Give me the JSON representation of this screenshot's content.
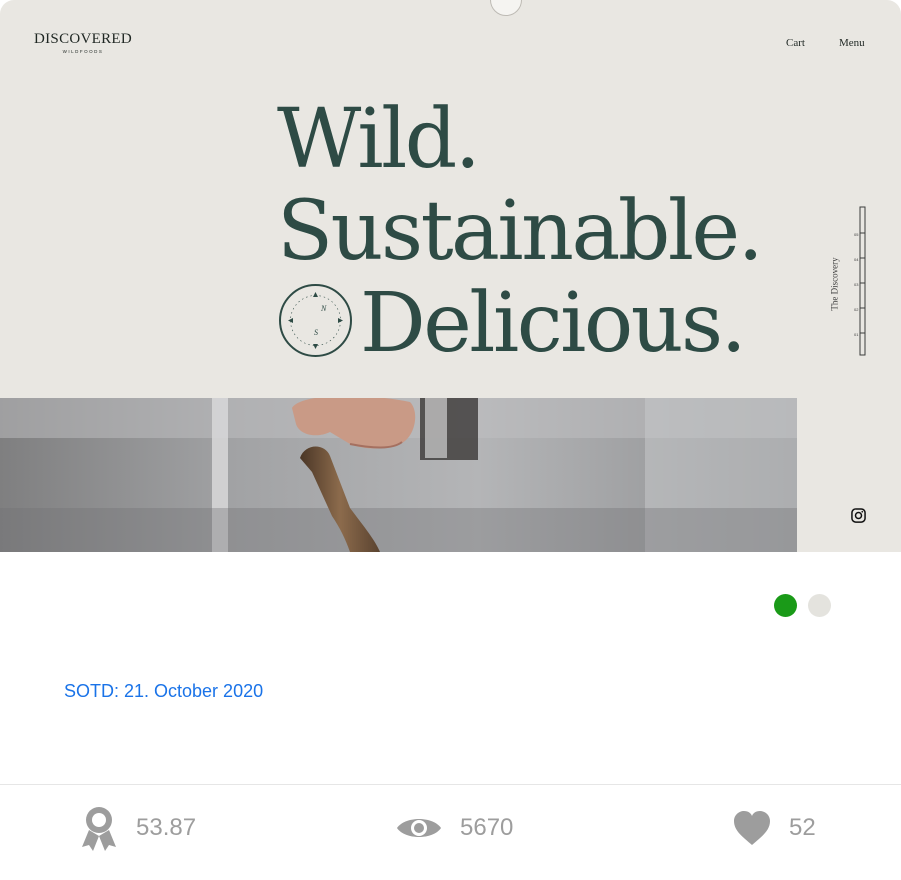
{
  "site": {
    "logo_main": "DISCOVERED",
    "logo_sub": "WILDFOODS",
    "nav": {
      "cart": "Cart",
      "menu": "Menu"
    },
    "headline": [
      "Wild.",
      "Sustainable.",
      "Delicious."
    ],
    "side_label": "The Discovery",
    "ruler_marks": [
      "05",
      "04",
      "03",
      "02",
      "01"
    ],
    "compass_letters": {
      "north": "N",
      "south": "S"
    }
  },
  "colors": {
    "background": "#e9e7e2",
    "headline": "#2e4b45",
    "dot_active": "#1a9a18",
    "dot_inactive": "#e4e3de",
    "link": "#1a73e8",
    "stat": "#9d9d9d"
  },
  "carousel": {
    "slides": 2,
    "active_index": 0
  },
  "award": {
    "label": "SOTD: 21. October 2020"
  },
  "stats": {
    "score": "53.87",
    "views": "5670",
    "likes": "52",
    "icons": [
      "award-ribbon-icon",
      "eye-icon",
      "heart-icon"
    ]
  }
}
